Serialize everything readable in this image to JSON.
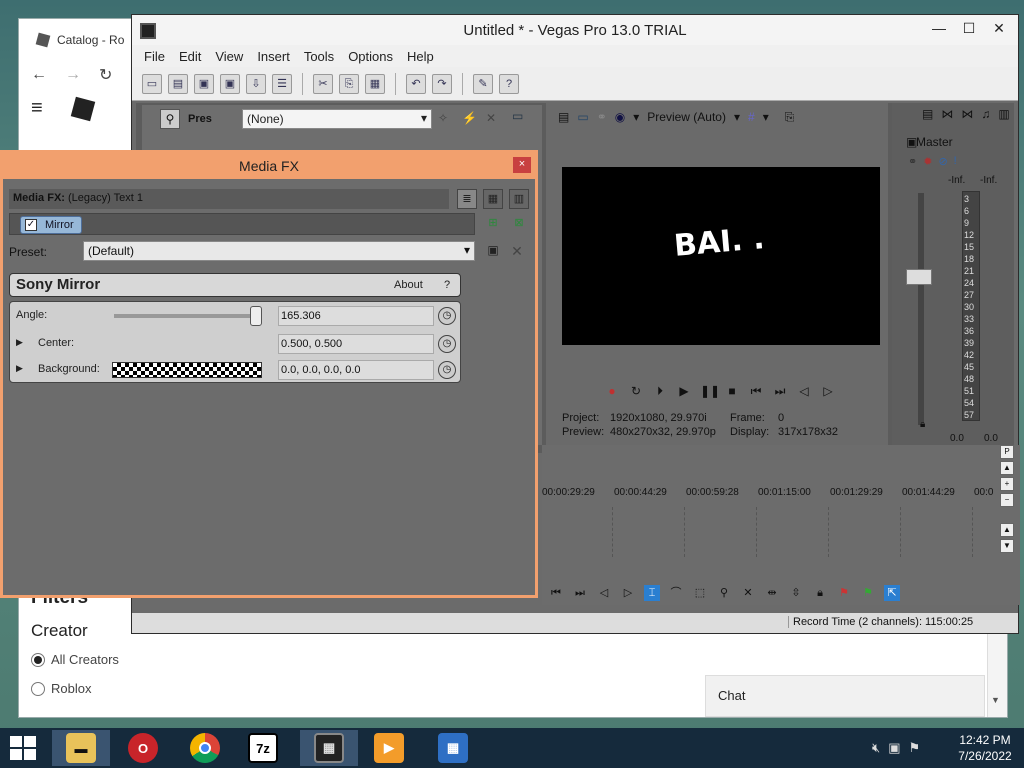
{
  "browser": {
    "tab_title": "Catalog - Ro",
    "filters_heading": "Filters",
    "creator_heading": "Creator",
    "creator_options": [
      "All Creators",
      "Roblox"
    ],
    "chat_label": "Chat"
  },
  "vegas": {
    "title": "Untitled * - Vegas Pro 13.0 TRIAL",
    "menu": [
      "File",
      "Edit",
      "View",
      "Insert",
      "Tools",
      "Options",
      "Help"
    ],
    "fx_chooser": {
      "preset_value": "(None)",
      "pres_label": "Pres"
    },
    "preview": {
      "mode_label": "Preview (Auto)",
      "overlay_text": "BAI. .",
      "project_label": "Project:",
      "project_value": "1920x1080, 29.970i",
      "frame_label": "Frame:",
      "frame_value": "0",
      "preview_label": "Preview:",
      "preview_value": "480x270x32, 29.970p",
      "display_label": "Display:",
      "display_value": "317x178x32"
    },
    "master": {
      "label": "Master",
      "inf_left": "-Inf.",
      "inf_right": "-Inf.",
      "scale": [
        "3",
        "6",
        "9",
        "12",
        "15",
        "18",
        "21",
        "24",
        "27",
        "30",
        "33",
        "36",
        "39",
        "42",
        "45",
        "48",
        "51",
        "54",
        "57"
      ],
      "value_left": "0.0",
      "value_right": "0.0"
    },
    "timeline": {
      "timecodes": [
        "00:00:29:29",
        "00:00:44:29",
        "00:00:59:28",
        "00:01:15:00",
        "00:01:29:29",
        "00:01:44:29",
        "00:0"
      ]
    },
    "status": {
      "record_time": "Record Time (2 channels): 115:00:25"
    }
  },
  "mediafx": {
    "title": "Media FX",
    "header_label": "Media FX:",
    "header_value": "(Legacy) Text 1",
    "chain_item": "Mirror",
    "preset_label": "Preset:",
    "preset_value": "(Default)",
    "plugin_name": "Sony Mirror",
    "about_label": "About",
    "help_label": "?",
    "params": [
      {
        "label": "Angle:",
        "value": "165.306"
      },
      {
        "label": "Center:",
        "value": "0.500, 0.500"
      },
      {
        "label": "Background:",
        "value": "0.0, 0.0, 0.0, 0.0"
      }
    ]
  },
  "taskbar": {
    "time": "12:42 PM",
    "date": "7/26/2022",
    "apps": [
      "file-explorer",
      "opera",
      "chrome",
      "7zip",
      "vegas",
      "media-player",
      "app"
    ],
    "seven_zip_label": "7z"
  }
}
